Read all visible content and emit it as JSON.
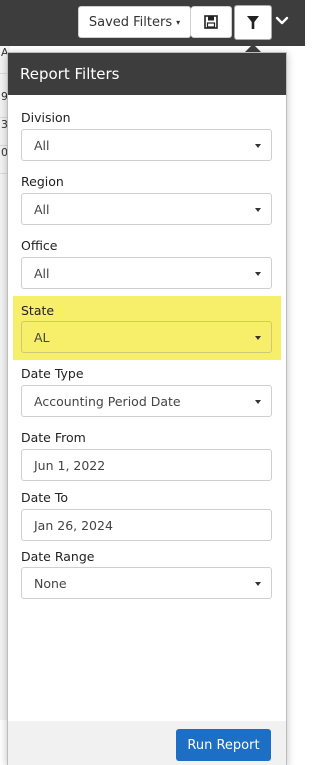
{
  "toolbar": {
    "saved_filters_label": "Saved Filters",
    "saved_filters_caret": "▾",
    "save_icon": "save-icon",
    "filter_icon": "filter-icon",
    "expand_icon": "chevron-down-icon"
  },
  "background": {
    "rows": [
      "A",
      "9",
      "3",
      "09"
    ]
  },
  "panel": {
    "title": "Report Filters",
    "fields": {
      "division": {
        "label": "Division",
        "value": "All"
      },
      "region": {
        "label": "Region",
        "value": "All"
      },
      "office": {
        "label": "Office",
        "value": "All"
      },
      "state": {
        "label": "State",
        "value": "AL"
      },
      "date_type": {
        "label": "Date Type",
        "value": "Accounting Period Date"
      },
      "date_from": {
        "label": "Date From",
        "value": "Jun 1, 2022"
      },
      "date_to": {
        "label": "Date To",
        "value": "Jan 26, 2024"
      },
      "date_range": {
        "label": "Date Range",
        "value": "None"
      }
    },
    "run_button": "Run Report"
  },
  "colors": {
    "header_bg": "#3d3d3d",
    "highlight": "#f7ee6a",
    "primary": "#1c6fc4"
  }
}
